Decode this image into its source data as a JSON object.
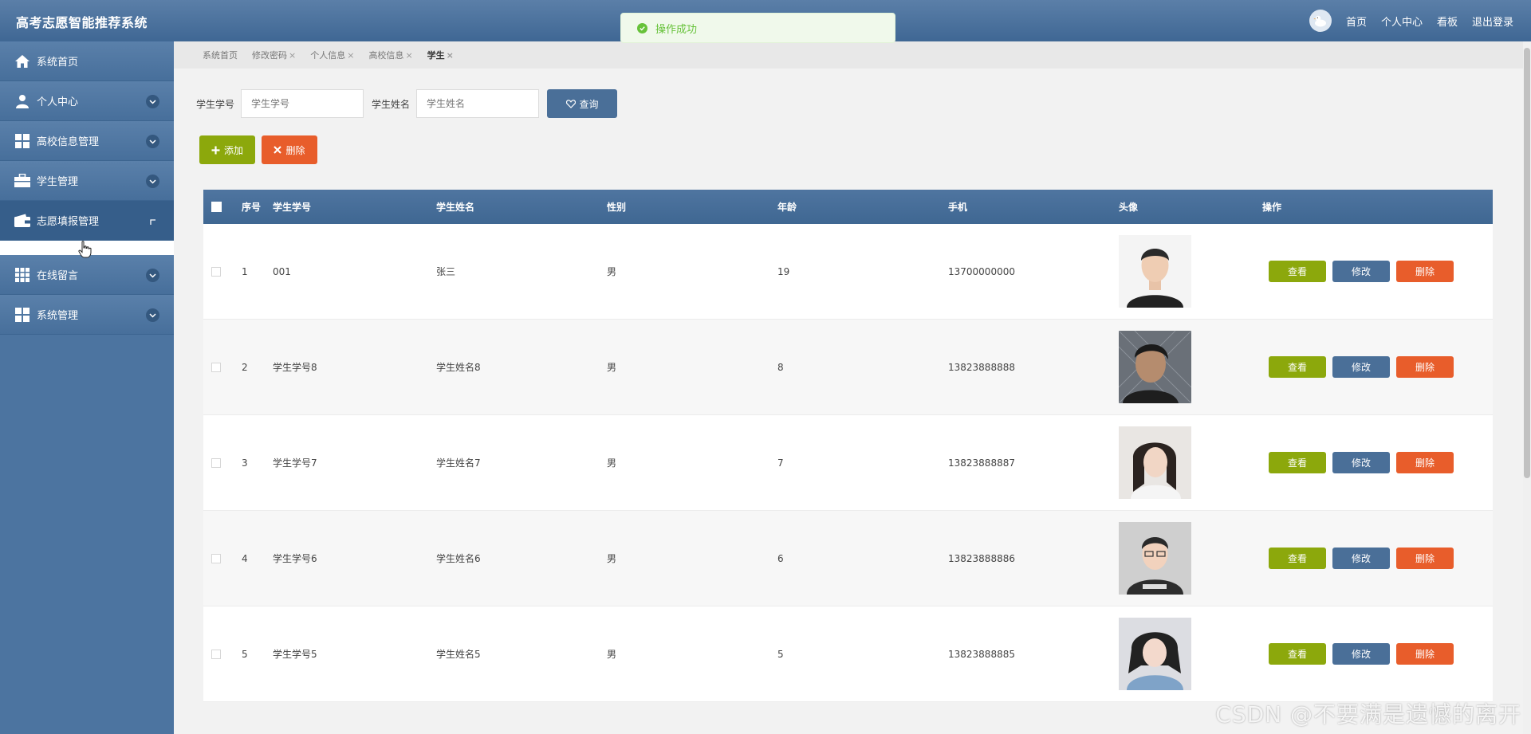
{
  "app": {
    "title": "高考志愿智能推荐系统"
  },
  "topnav": {
    "home": "首页",
    "personal": "个人中心",
    "board": "看板",
    "logout": "退出登录"
  },
  "toast": {
    "message": "操作成功"
  },
  "sidebar": {
    "items": [
      {
        "label": "系统首页",
        "icon": "home-icon"
      },
      {
        "label": "个人中心",
        "icon": "user-icon"
      },
      {
        "label": "高校信息管理",
        "icon": "grid-icon"
      },
      {
        "label": "学生管理",
        "icon": "briefcase-icon"
      },
      {
        "label": "志愿填报管理",
        "icon": "wallet-icon"
      },
      {
        "label": "在线留言",
        "icon": "apps-icon"
      },
      {
        "label": "系统管理",
        "icon": "grid-icon"
      }
    ]
  },
  "tags": [
    "系统首页",
    "修改密码",
    "个人信息",
    "高校信息",
    "学生"
  ],
  "search": {
    "no_label": "学生学号",
    "no_placeholder": "学生学号",
    "name_label": "学生姓名",
    "name_placeholder": "学生姓名",
    "query_label": "查询"
  },
  "actions": {
    "add": "添加",
    "delete": "删除"
  },
  "table": {
    "headers": [
      "序号",
      "学生学号",
      "学生姓名",
      "性别",
      "年龄",
      "手机",
      "头像",
      "操作"
    ],
    "ops": {
      "view": "查看",
      "edit": "修改",
      "remove": "删除"
    },
    "rows": [
      {
        "idx": "1",
        "no": "001",
        "name": "张三",
        "sex": "男",
        "age": "19",
        "phone": "13700000000"
      },
      {
        "idx": "2",
        "no": "学生学号8",
        "name": "学生姓名8",
        "sex": "男",
        "age": "8",
        "phone": "13823888888"
      },
      {
        "idx": "3",
        "no": "学生学号7",
        "name": "学生姓名7",
        "sex": "男",
        "age": "7",
        "phone": "13823888887"
      },
      {
        "idx": "4",
        "no": "学生学号6",
        "name": "学生姓名6",
        "sex": "男",
        "age": "6",
        "phone": "13823888886"
      },
      {
        "idx": "5",
        "no": "学生学号5",
        "name": "学生姓名5",
        "sex": "男",
        "age": "5",
        "phone": "13823888885"
      }
    ]
  },
  "watermark": "CSDN @不要满是遗憾的离开",
  "colors": {
    "header": "#4a6f98",
    "green": "#8ca80c",
    "red": "#e85d2b",
    "blue": "#4a6f98"
  }
}
